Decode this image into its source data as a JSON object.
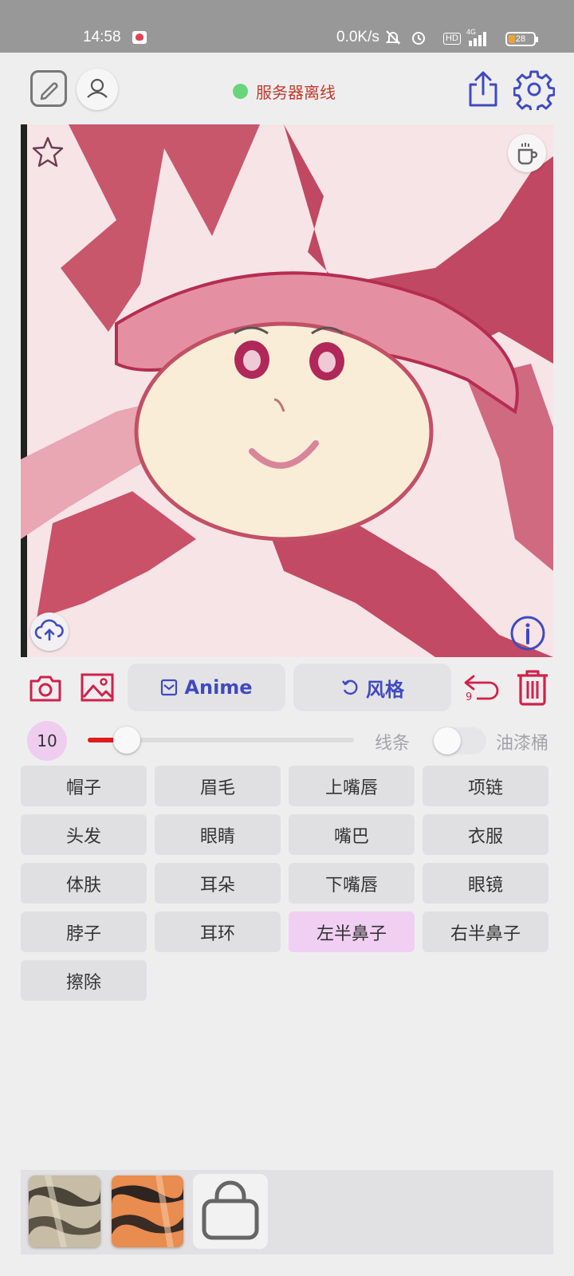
{
  "status_bar": {
    "time": "14:58",
    "net_speed": "0.0K/s",
    "hd": "HD",
    "net_type": "4G",
    "battery": "28"
  },
  "header": {
    "server_status": "服务器离线",
    "server_status_color": "#6ad47a"
  },
  "toolbar": {
    "anime_label": "Anime",
    "style_label": "风格",
    "undo_count": "9"
  },
  "brush": {
    "size": "10",
    "slider_fraction": 0.12,
    "lines_label": "线条",
    "bucket_label": "油漆桶",
    "bucket_enabled": false
  },
  "parts": [
    {
      "label": "帽子"
    },
    {
      "label": "眉毛"
    },
    {
      "label": "上嘴唇"
    },
    {
      "label": "项链"
    },
    {
      "label": "头发"
    },
    {
      "label": "眼睛"
    },
    {
      "label": "嘴巴"
    },
    {
      "label": "衣服"
    },
    {
      "label": "体肤"
    },
    {
      "label": "耳朵"
    },
    {
      "label": "下嘴唇"
    },
    {
      "label": "眼镜"
    },
    {
      "label": "脖子"
    },
    {
      "label": "耳环"
    },
    {
      "label": "左半鼻子",
      "active": true
    },
    {
      "label": "右半鼻子"
    },
    {
      "label": "擦除"
    }
  ],
  "colors": {
    "accent_blue": "#3f4ac0",
    "accent_red": "#d0214b",
    "active_part": "#f0cff3"
  },
  "icons": [
    "edit-icon",
    "user-icon",
    "share-icon",
    "gear-icon",
    "star-icon",
    "coffee-icon",
    "cloud-upload-icon",
    "info-icon",
    "camera-icon",
    "image-icon",
    "checkbox-icon",
    "refresh-icon",
    "undo-icon",
    "trash-icon",
    "shopping-bag-icon"
  ]
}
